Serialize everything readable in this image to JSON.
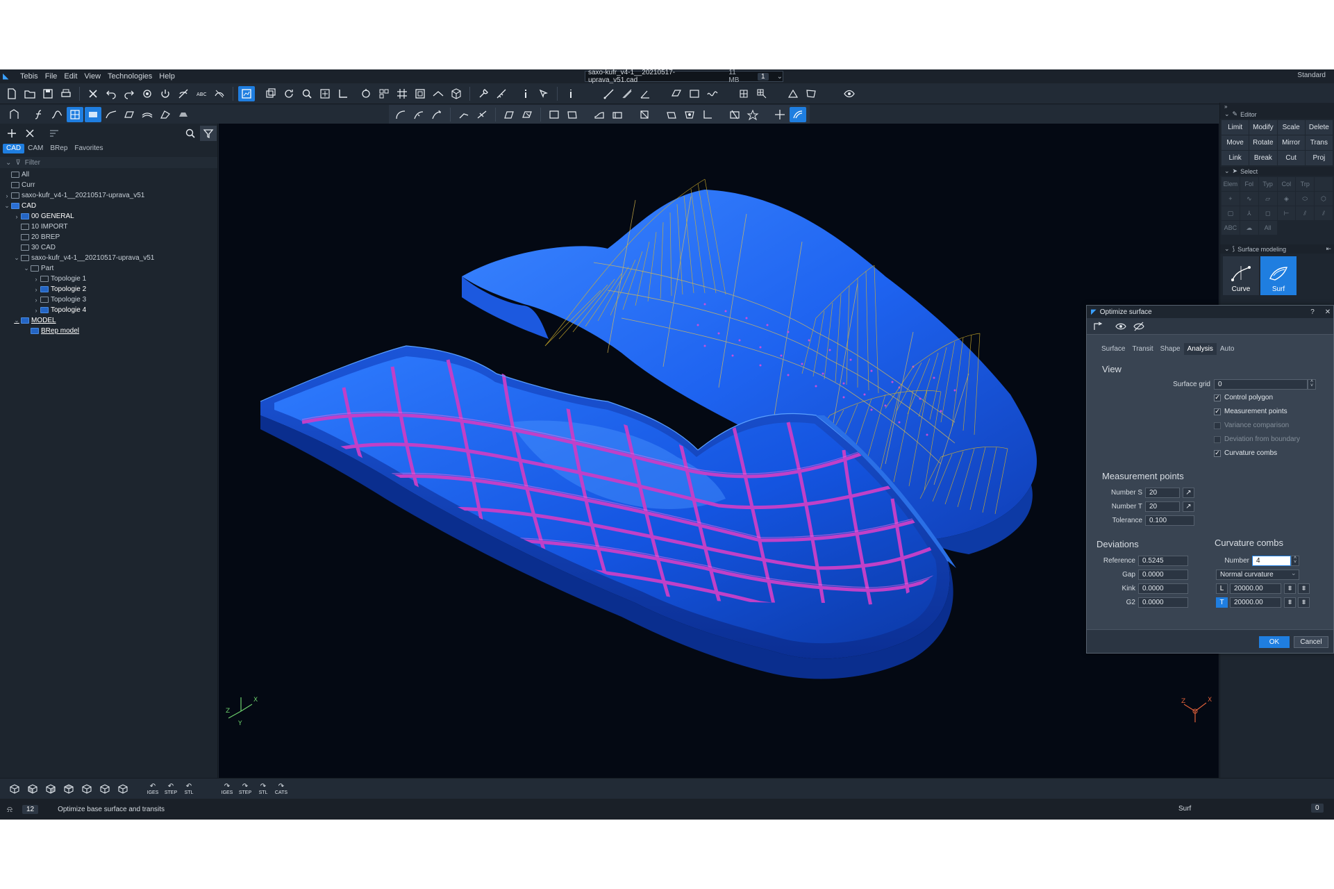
{
  "menubar": {
    "app_name": "Tebis",
    "items": [
      "File",
      "Edit",
      "View",
      "Technologies",
      "Help"
    ],
    "file_title": "saxo-kufr_v4-1__20210517-uprava_v51.cad",
    "file_size": "11 MB",
    "window_badge": "1",
    "workspace": "Standard"
  },
  "left_panel": {
    "tabs": [
      "CAD",
      "CAM",
      "BRep",
      "Favorites"
    ],
    "active_tab": "CAD",
    "filter_label": "Filter",
    "tree": [
      {
        "label": "All",
        "indent": 0,
        "twisty": "",
        "icon": "folder",
        "style": ""
      },
      {
        "label": "Curr",
        "indent": 0,
        "twisty": "",
        "icon": "folder",
        "style": ""
      },
      {
        "label": "saxo-kufr_v4-1__20210517-uprava_v51",
        "indent": 0,
        "twisty": ">",
        "icon": "folder",
        "style": ""
      },
      {
        "label": "CAD",
        "indent": 0,
        "twisty": "v",
        "icon": "cad",
        "style": "bold"
      },
      {
        "label": "00 GENERAL",
        "indent": 1,
        "twisty": ">",
        "icon": "blue",
        "style": "bold"
      },
      {
        "label": "10 IMPORT",
        "indent": 1,
        "twisty": "",
        "icon": "folder",
        "style": ""
      },
      {
        "label": "20 BREP",
        "indent": 1,
        "twisty": "",
        "icon": "folder",
        "style": ""
      },
      {
        "label": "30 CAD",
        "indent": 1,
        "twisty": "",
        "icon": "folder",
        "style": ""
      },
      {
        "label": "saxo-kufr_v4-1__20210517-uprava_v51",
        "indent": 1,
        "twisty": "v",
        "icon": "folder",
        "style": ""
      },
      {
        "label": "Part",
        "indent": 2,
        "twisty": "v",
        "icon": "folder",
        "style": ""
      },
      {
        "label": "Topologie 1",
        "indent": 3,
        "twisty": ">",
        "icon": "folder",
        "style": ""
      },
      {
        "label": "Topologie 2",
        "indent": 3,
        "twisty": ">",
        "icon": "blue",
        "style": "bold"
      },
      {
        "label": "Topologie 3",
        "indent": 3,
        "twisty": ">",
        "icon": "folder",
        "style": ""
      },
      {
        "label": "Topologie 4",
        "indent": 3,
        "twisty": ">",
        "icon": "blue",
        "style": "bold"
      },
      {
        "label": "MODEL",
        "indent": 1,
        "twisty": "v",
        "icon": "blue",
        "style": "link"
      },
      {
        "label": "BRep model",
        "indent": 2,
        "twisty": "",
        "icon": "blue",
        "style": "link"
      }
    ]
  },
  "viewport": {
    "axis_left": [
      "Z",
      "Y",
      "X"
    ],
    "axis_right": [
      "Z",
      "X"
    ]
  },
  "right_panel": {
    "editor_title": "Editor",
    "editor_buttons": [
      "Limit",
      "Modify",
      "Scale",
      "Delete",
      "Move",
      "Rotate",
      "Mirror",
      "Trans",
      "Link",
      "Break",
      "Cut",
      "Proj"
    ],
    "select_title": "Select",
    "select_headers": [
      "Elem",
      "Fol",
      "Typ",
      "Col",
      "Trp"
    ],
    "select_all": "All",
    "select_abc": "ABC",
    "surface_modeling_title": "Surface modeling",
    "tiles": [
      {
        "label": "Curve",
        "active": false
      },
      {
        "label": "Surf",
        "active": true
      }
    ]
  },
  "dialog": {
    "title": "Optimize surface",
    "help": "?",
    "close": "✕",
    "tabs": [
      "Surface",
      "Transit",
      "Shape",
      "Analysis",
      "Auto"
    ],
    "active_tab": "Analysis",
    "view_section": "View",
    "surface_grid_label": "Surface grid",
    "surface_grid_value": "0",
    "checks": [
      {
        "label": "Control polygon",
        "checked": true,
        "disabled": false
      },
      {
        "label": "Measurement points",
        "checked": true,
        "disabled": false
      },
      {
        "label": "Variance comparison",
        "checked": false,
        "disabled": true
      },
      {
        "label": "Deviation from boundary",
        "checked": false,
        "disabled": true
      },
      {
        "label": "Curvature combs",
        "checked": true,
        "disabled": false
      }
    ],
    "measurement_section": "Measurement points",
    "number_s_label": "Number S",
    "number_s_value": "20",
    "number_t_label": "Number T",
    "number_t_value": "20",
    "tolerance_label": "Tolerance",
    "tolerance_value": "0.100",
    "deviations_section": "Deviations",
    "reference_label": "Reference",
    "reference_value": "0.5245",
    "gap_label": "Gap",
    "gap_value": "0.0000",
    "kink_label": "Kink",
    "kink_value": "0.0000",
    "g2_label": "G2",
    "g2_value": "0.0000",
    "combs_section": "Curvature combs",
    "number_label": "Number",
    "number_value": "4",
    "curvature_type": "Normal curvature",
    "l_label": "L",
    "l_value": "20000.00",
    "t_label": "T",
    "t_value": "20000.00",
    "ok_label": "OK",
    "cancel_label": "Cancel"
  },
  "bottom_toolbar": {
    "export_labels": [
      "IGES",
      "STEP",
      "STL",
      "IGES",
      "STEP",
      "STL",
      "CATS"
    ]
  },
  "statusbar": {
    "count": "12",
    "message": "Optimize base surface and transits",
    "mode": "Surf",
    "right_count": "0"
  },
  "colors": {
    "accent": "#1f7ee0",
    "surface_blue": "#1a5fe6",
    "rib_magenta": "#c040c8",
    "comb_yellow": "#d6b32a",
    "viewport_bg": "#040913"
  }
}
